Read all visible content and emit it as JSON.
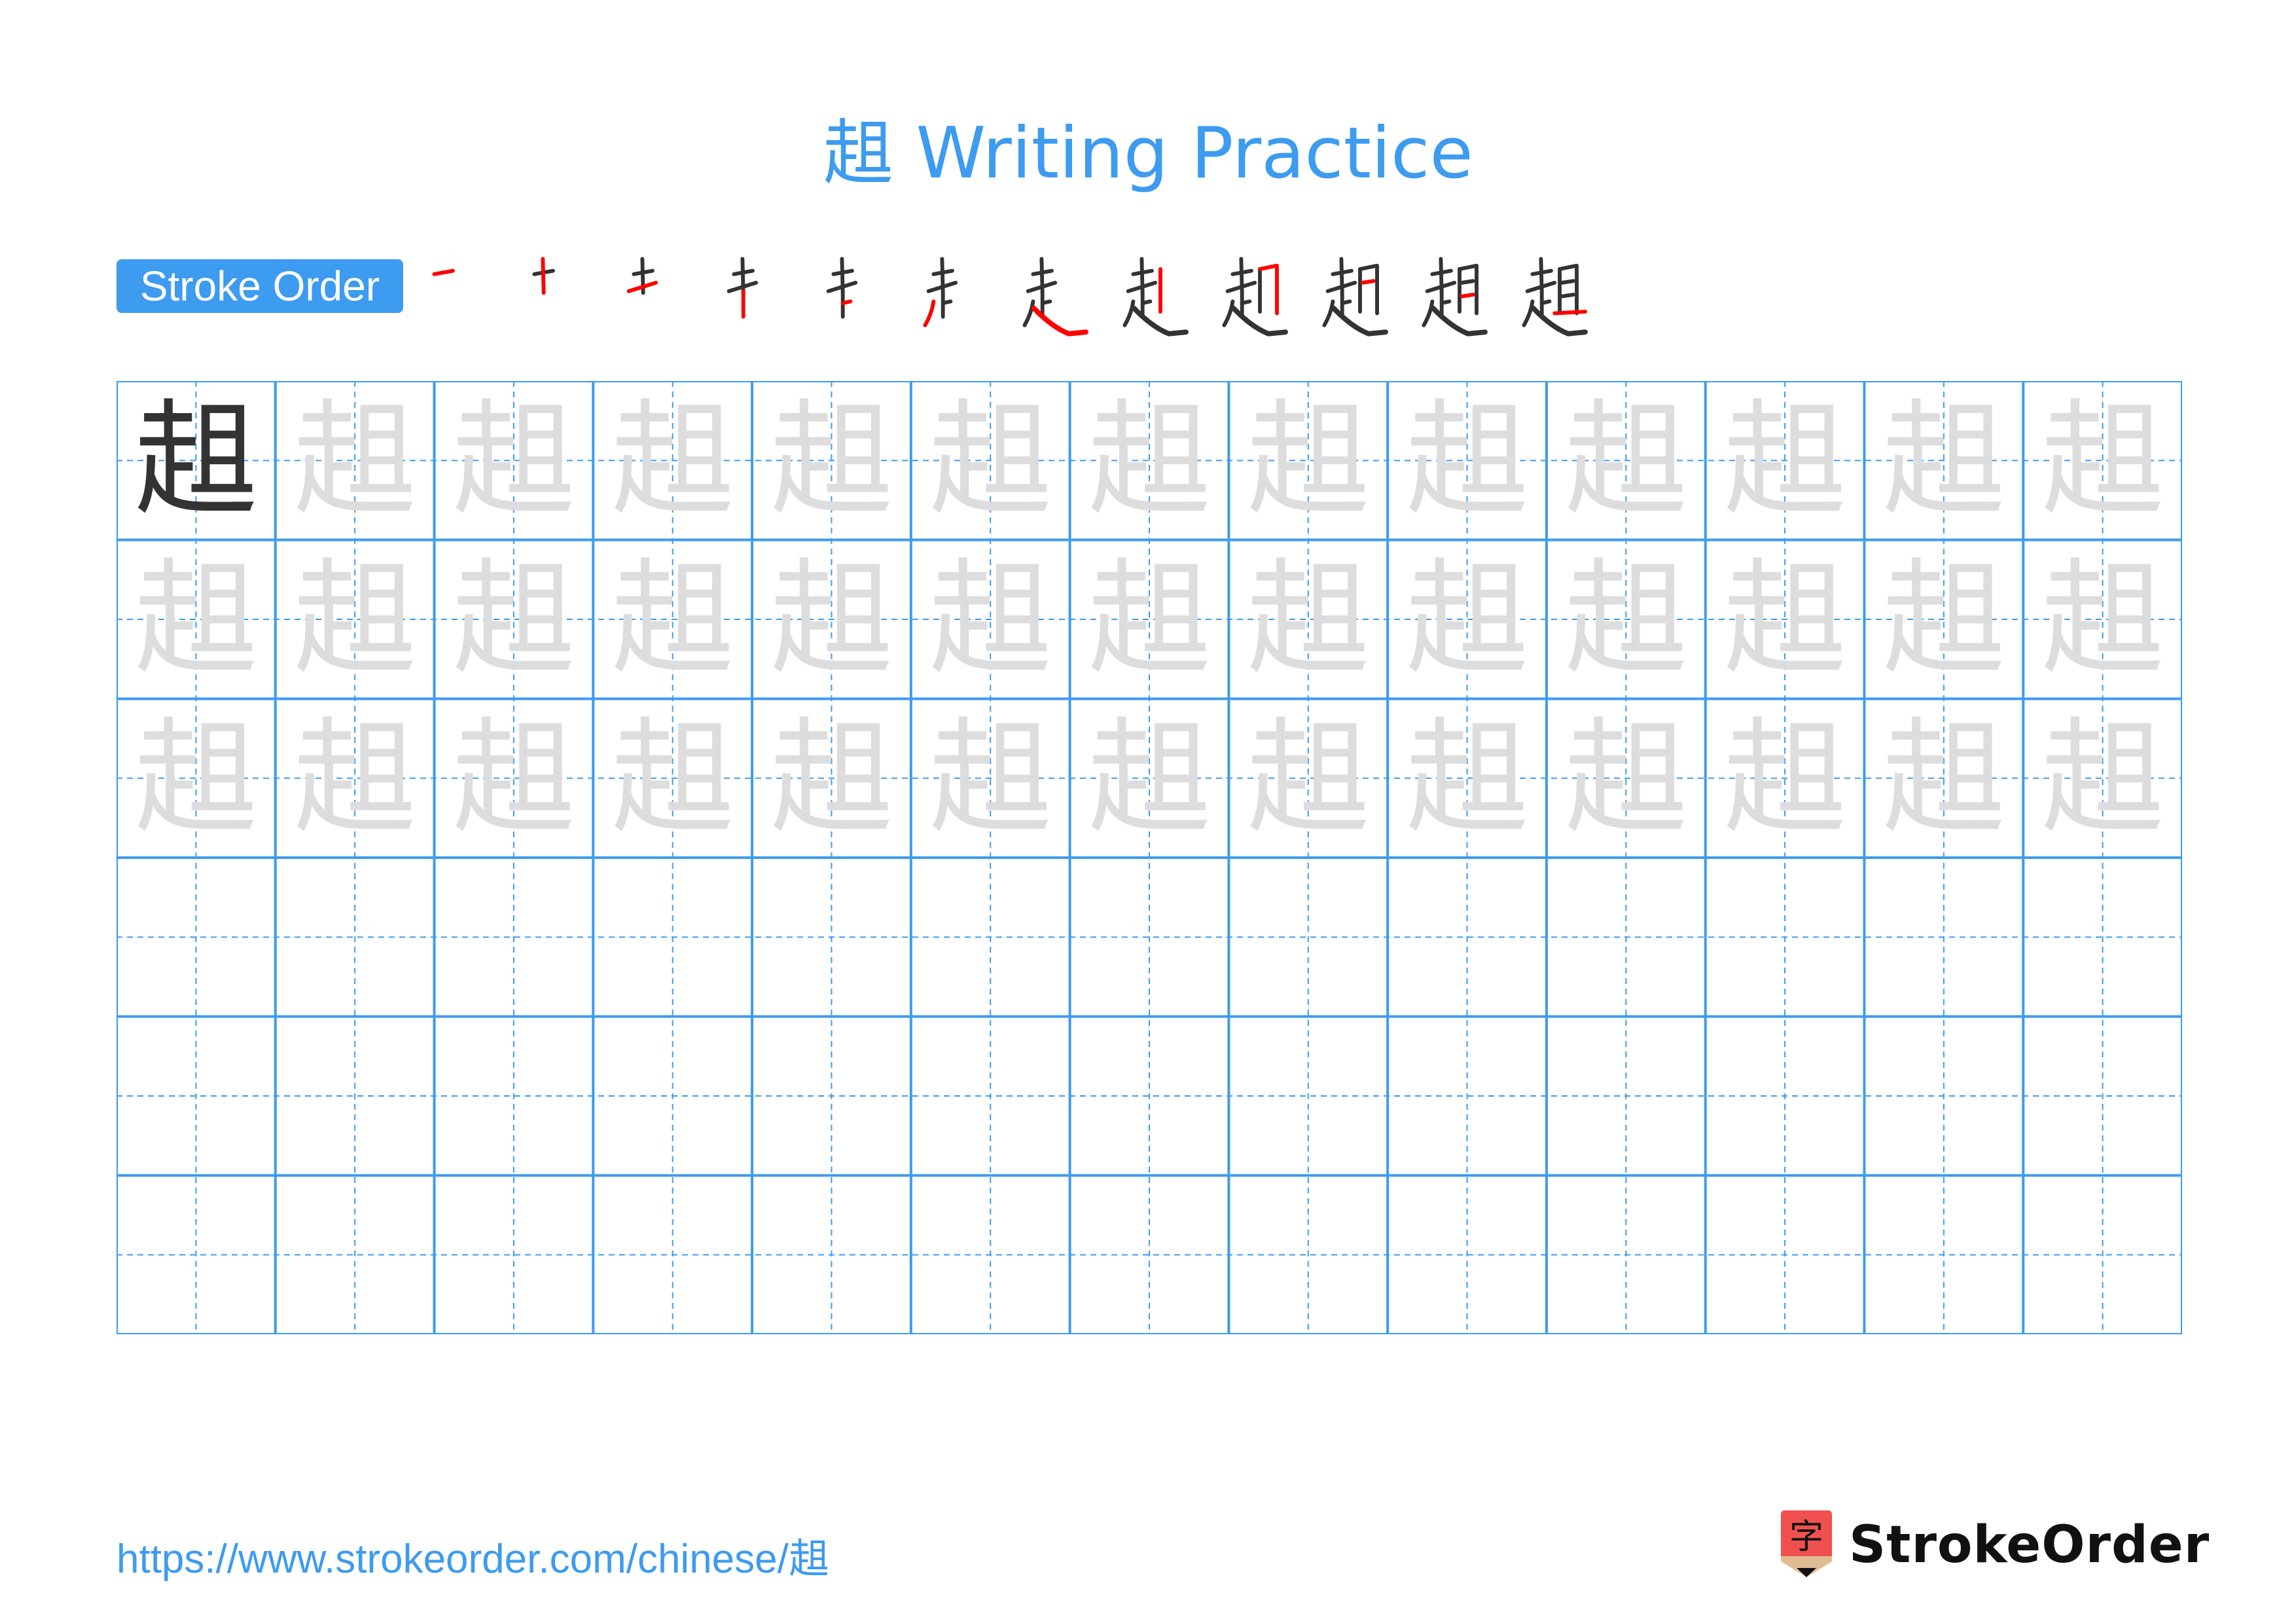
{
  "page": {
    "title": "趄 Writing Practice",
    "character": "趄"
  },
  "stroke_order": {
    "label": "Stroke Order",
    "step_count": 12,
    "colors": {
      "done": "#333333",
      "current": "#ff0000"
    }
  },
  "grid": {
    "columns": 13,
    "rows": 6,
    "model_cells": 1,
    "trace_rows": 3,
    "empty_rows": 3,
    "line_color": "#3d9bf0",
    "model_color": "#333333",
    "trace_color": "#dddddd"
  },
  "footer": {
    "url": "https://www.strokeorder.com/chinese/趄",
    "brand": "StrokeOrder",
    "logo_glyph": "字"
  },
  "colors": {
    "accent": "#3d9bf0",
    "logo_red": "#f05050",
    "logo_tan": "#e0bc94"
  }
}
